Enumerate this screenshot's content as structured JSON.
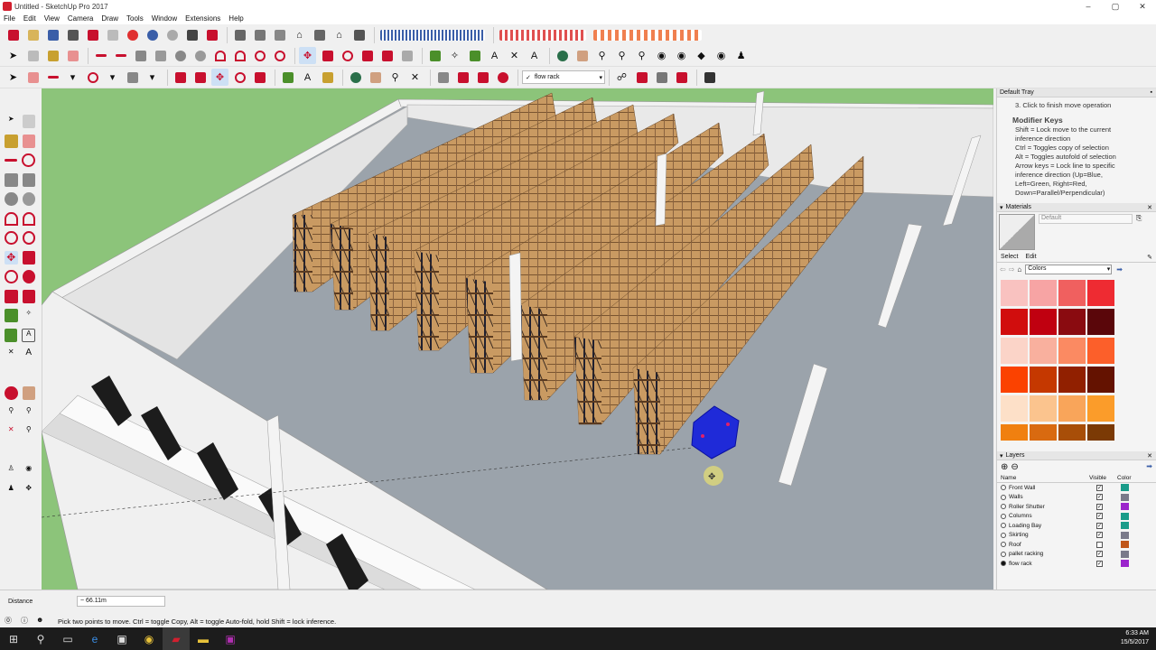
{
  "window": {
    "title": "Untitled - SketchUp Pro 2017",
    "minimize": "–",
    "maximize": "▢",
    "close": "✕"
  },
  "menu": [
    "File",
    "Edit",
    "View",
    "Camera",
    "Draw",
    "Tools",
    "Window",
    "Extensions",
    "Help"
  ],
  "toolbar3": {
    "layer_select": "flow rack"
  },
  "tray": {
    "title": "Default Tray",
    "instructions": {
      "step": "3. Click to finish move operation",
      "heading": "Modifier Keys",
      "lines": [
        "Shift = Lock move to the current",
        "inference direction",
        "Ctrl = Toggles copy of selection",
        "Alt = Toggles autofold of selection",
        "Arrow keys = Lock line to specific",
        "inference direction (Up=Blue,",
        "Left=Green, Right=Red,",
        "Down=Parallel/Perpendicular)"
      ]
    },
    "materials": {
      "title": "Materials",
      "current": "Default",
      "tab_select": "Select",
      "tab_edit": "Edit",
      "library": "Colors",
      "swatches": [
        "#f9c2c0",
        "#f7a4a4",
        "#f0605f",
        "#ee2b32",
        "#d10d0d",
        "#c00010",
        "#8a0b10",
        "#5a060a",
        "#fbd4c8",
        "#f9b09e",
        "#fb8a62",
        "#fc5f2a",
        "#fb4200",
        "#c53800",
        "#912000",
        "#641200",
        "#fde0c8",
        "#fbc48e",
        "#f9a55a",
        "#fb9c2a",
        "#f08010",
        "#d96a10",
        "#a84e08",
        "#7b3a05"
      ]
    },
    "layers": {
      "title": "Layers",
      "col_name": "Name",
      "col_visible": "Visible",
      "col_color": "Color",
      "items": [
        {
          "name": "Front Wall",
          "visible": true,
          "active": false,
          "color": "#1a9c8a"
        },
        {
          "name": "Walls",
          "visible": true,
          "active": false,
          "color": "#7a7a8a"
        },
        {
          "name": "Roller Shutter",
          "visible": true,
          "active": false,
          "color": "#9b24cc"
        },
        {
          "name": "Columns",
          "visible": true,
          "active": false,
          "color": "#1a9c8a"
        },
        {
          "name": "Loading Bay",
          "visible": true,
          "active": false,
          "color": "#1a9c8a"
        },
        {
          "name": "Skirting",
          "visible": true,
          "active": false,
          "color": "#7a7a8a"
        },
        {
          "name": "Roof",
          "visible": false,
          "active": false,
          "color": "#c0561a"
        },
        {
          "name": "pallet racking",
          "visible": true,
          "active": false,
          "color": "#7a7a8a"
        },
        {
          "name": "flow rack",
          "visible": true,
          "active": true,
          "color": "#9b24cc"
        }
      ]
    }
  },
  "status": {
    "measure_label": "Distance",
    "measure_value": "~ 66.11m",
    "hint": "Pick two points to move.  Ctrl = toggle Copy, Alt = toggle Auto-fold, hold Shift = lock inference."
  },
  "taskbar": {
    "time": "6:33 AM",
    "date": "15/5/2017"
  }
}
